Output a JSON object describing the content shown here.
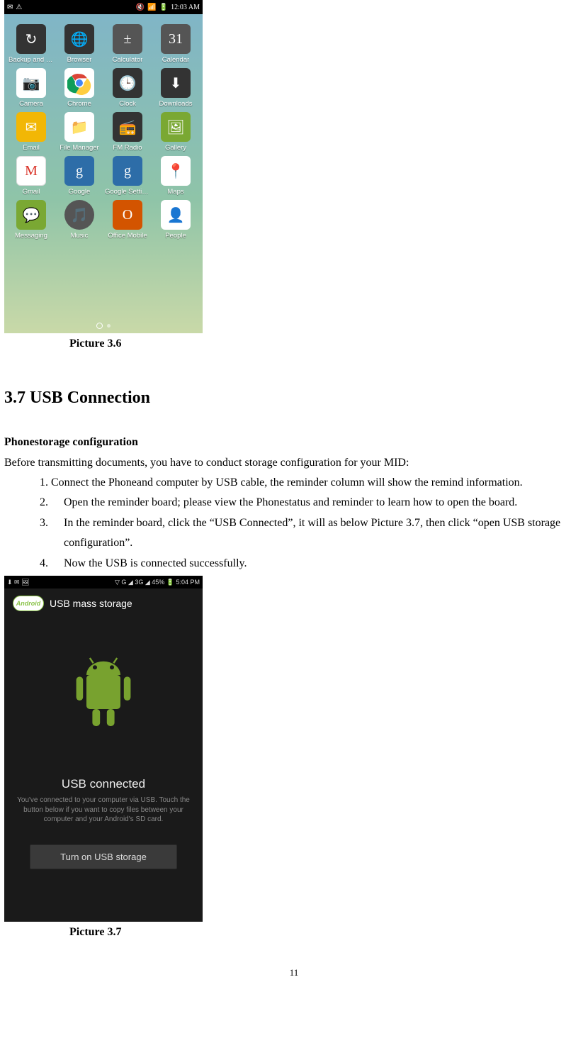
{
  "screenshot1": {
    "status": {
      "time": "12:03 AM",
      "icons_left": [
        "✉",
        "⚠"
      ],
      "icons_right": [
        "🔇",
        "📶",
        "🔋"
      ]
    },
    "apps": [
      {
        "name": "Backup and Re",
        "icon": "backup-icon",
        "bg": "bg-dark",
        "glyph": "↻"
      },
      {
        "name": "Browser",
        "icon": "browser-icon",
        "bg": "bg-dark",
        "glyph": "🌐"
      },
      {
        "name": "Calculator",
        "icon": "calculator-icon",
        "bg": "bg-grey",
        "glyph": "±"
      },
      {
        "name": "Calendar",
        "icon": "calendar-icon",
        "bg": "bg-grey",
        "glyph": "31"
      },
      {
        "name": "Camera",
        "icon": "camera-icon",
        "bg": "bg-white",
        "glyph": "📷"
      },
      {
        "name": "Chrome",
        "icon": "chrome-icon",
        "bg": "bg-chrome",
        "glyph": ""
      },
      {
        "name": "Clock",
        "icon": "clock-icon",
        "bg": "bg-dark",
        "glyph": "🕒"
      },
      {
        "name": "Downloads",
        "icon": "downloads-icon",
        "bg": "bg-dark",
        "glyph": "⬇"
      },
      {
        "name": "Email",
        "icon": "email-icon",
        "bg": "bg-yellow",
        "glyph": "✉"
      },
      {
        "name": "File Manager",
        "icon": "file-manager-icon",
        "bg": "bg-white",
        "glyph": "📁"
      },
      {
        "name": "FM Radio",
        "icon": "fm-radio-icon",
        "bg": "bg-dark",
        "glyph": "📻"
      },
      {
        "name": "Gallery",
        "icon": "gallery-icon",
        "bg": "bg-green",
        "glyph": "🖼"
      },
      {
        "name": "Gmail",
        "icon": "gmail-icon",
        "bg": "bg-gmail",
        "glyph": "M"
      },
      {
        "name": "Google",
        "icon": "google-icon",
        "bg": "bg-blue",
        "glyph": "g"
      },
      {
        "name": "Google Settings",
        "icon": "google-settings-icon",
        "bg": "bg-blue",
        "glyph": "g"
      },
      {
        "name": "Maps",
        "icon": "maps-icon",
        "bg": "bg-maps",
        "glyph": "📍"
      },
      {
        "name": "Messaging",
        "icon": "messaging-icon",
        "bg": "bg-green",
        "glyph": "💬"
      },
      {
        "name": "Music",
        "icon": "music-icon",
        "bg": "bg-purple bg-round",
        "glyph": "🎵"
      },
      {
        "name": "Office Mobile",
        "icon": "office-icon",
        "bg": "bg-orange",
        "glyph": "O"
      },
      {
        "name": "People",
        "icon": "people-icon",
        "bg": "bg-white",
        "glyph": "👤"
      }
    ]
  },
  "caption1": "Picture 3.6",
  "heading": "3.7 USB Connection",
  "subheading": "Phonestorage configuration",
  "intro": "Before transmitting documents, you have to conduct storage configuration for your MID:",
  "steps": [
    "1. Connect the Phoneand computer by USB cable, the reminder column will show the remind information.",
    "Open the reminder board; please view the Phonestatus and reminder to learn how to open the board.",
    "In the reminder board, click the “USB Connected”, it will as below Picture 3.7, then click “open USB storage configuration”.",
    "Now the USB is connected successfully."
  ],
  "step_numbers": [
    "",
    "2.",
    "3.",
    "4."
  ],
  "screenshot2": {
    "status": {
      "left": "⬇ ✉ 🖼",
      "right": "▽ G ◢ 3G ◢ 45% 🔋 5:04 PM"
    },
    "badge": "Android",
    "title": "USB mass storage",
    "connected_title": "USB connected",
    "connected_body": "You've connected to your computer via USB. Touch the button below if you want to copy files between your computer and your Android's SD card.",
    "button": "Turn on USB storage"
  },
  "caption2": "Picture 3.7",
  "page_number": "11"
}
